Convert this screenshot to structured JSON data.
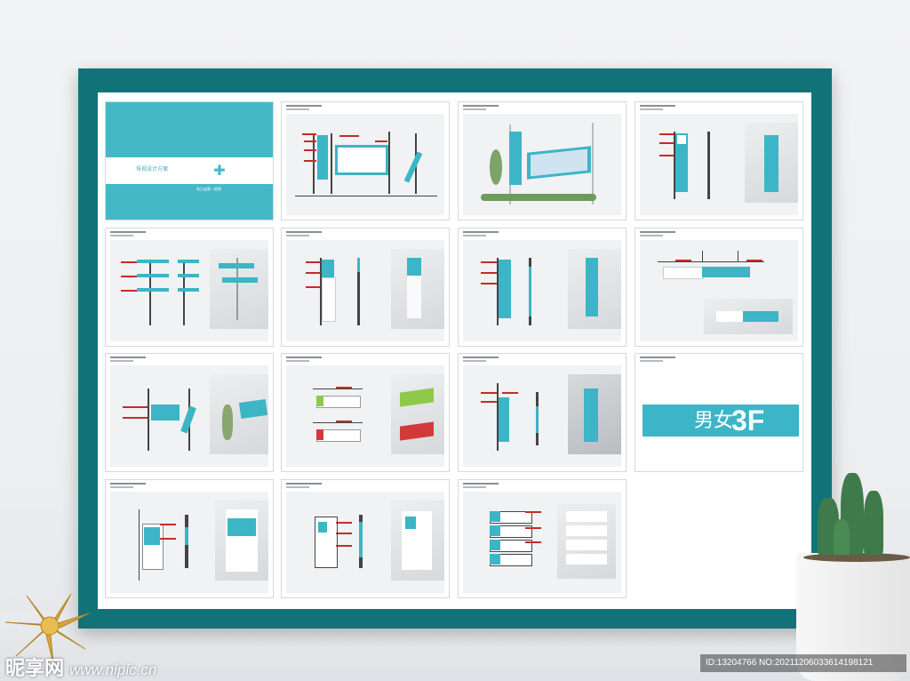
{
  "cover": {
    "title": "导视设计方案",
    "org": "浙江省第一医院"
  },
  "restroom_board": {
    "icon": "男女",
    "floor": "3F"
  },
  "watermark": {
    "brand": "昵享网",
    "site": "www.nipic.cn"
  },
  "image_id": "ID:13204766 NO:20211206033614198121",
  "colors": {
    "frame": "#117378",
    "brand": "#3cb5c6",
    "label": "#c62b2b"
  }
}
